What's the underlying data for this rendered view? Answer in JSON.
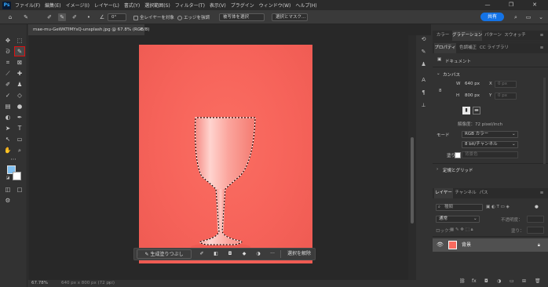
{
  "menubar": {
    "logo": "Ps",
    "items": [
      "ファイル(F)",
      "編集(E)",
      "イメージ(I)",
      "レイヤー(L)",
      "書式(Y)",
      "選択範囲(S)",
      "フィルター(T)",
      "表示(V)",
      "プラグイン",
      "ウィンドウ(W)",
      "ヘルプ(H)"
    ],
    "window_controls": [
      "—",
      "❐",
      "✕"
    ]
  },
  "options_bar": {
    "angle": "0°",
    "sample_all_layers": "全レイヤーを対象",
    "enhance_edge": "エッジを強調",
    "select_subject": "被写体を選択",
    "select_and_mask": "選択とマスク...",
    "share": "共有"
  },
  "document": {
    "tab_title": "mae-mu-GeWKTIMYsQ-unsplash.jpg @ 67.8% (RGB/8)",
    "tab_close": "×",
    "zoom": "67.78%",
    "dimensions": "640 px x 800 px (72 ppi)"
  },
  "contextual_taskbar": {
    "generative_fill": "生成塗りつぶし",
    "deselect": "選択を解除",
    "more": "···"
  },
  "panels": {
    "top_tabs": [
      "カラー",
      "グラデーション",
      "パターン",
      "スウォッチ"
    ],
    "properties_tabs": [
      "プロパティ",
      "色調補正",
      "CC ライブラリ"
    ],
    "document_label": "ドキュメント",
    "canvas_section": "カンバス",
    "width_label": "W",
    "width_value": "640 px",
    "height_label": "H",
    "height_value": "800 px",
    "x_label": "X",
    "x_value": "0 px",
    "y_label": "Y",
    "y_value": "0 px",
    "resolution": "解像度：72 pixel/inch",
    "mode_label": "モード",
    "mode_value": "RGB カラー",
    "bit_depth": "8 bit/チャンネル",
    "fill_label": "塗り",
    "fill_value": "背景色",
    "rulers_section": "定規とグリッド"
  },
  "layers": {
    "tabs": [
      "レイヤー",
      "チャンネル",
      "パス"
    ],
    "search_placeholder": "種類",
    "blend_mode": "通常",
    "opacity_label": "不透明度：",
    "lock_label": "ロック：",
    "fill_label": "塗り：",
    "layer_name": "背景"
  },
  "colors": {
    "canvas_bg": "#f6635a",
    "accent": "#1473e6",
    "active_tool_outline": "#dd1111"
  }
}
